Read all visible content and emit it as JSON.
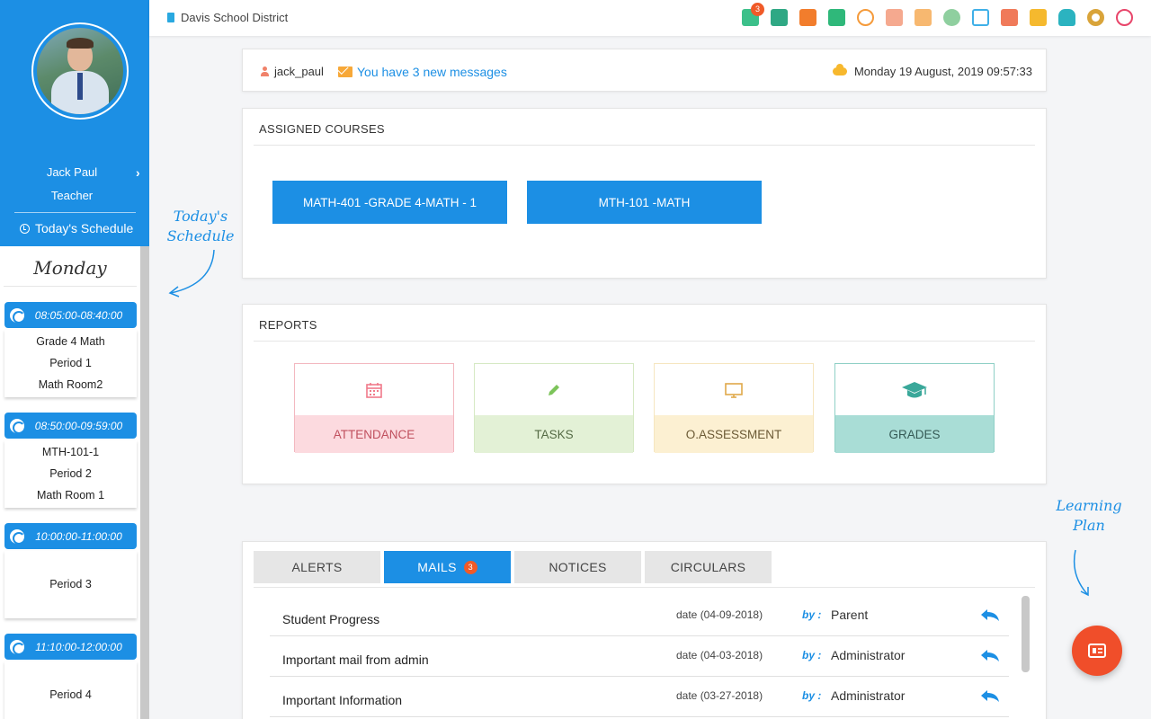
{
  "app": {
    "district": "Davis School District"
  },
  "topbar": {
    "icons": [
      {
        "name": "mail-icon",
        "color": "#3cc08a",
        "badge": "3"
      },
      {
        "name": "folder-icon",
        "color": "#2fa884"
      },
      {
        "name": "contact-card-icon",
        "color": "#f27d2c"
      },
      {
        "name": "presentation-icon",
        "color": "#2fb87a"
      },
      {
        "name": "gauge-icon",
        "color": "#f59a3a"
      },
      {
        "name": "id-card-icon",
        "color": "#f07a5a"
      },
      {
        "name": "bar-chart-icon",
        "color": "#f59a3a"
      },
      {
        "name": "alert-icon",
        "color": "#8fcf9f"
      },
      {
        "name": "folder-outline-icon",
        "color": "#3fb0e8"
      },
      {
        "name": "question-icon",
        "color": "#f07a5a"
      },
      {
        "name": "calendar-icon",
        "color": "#f5b92e"
      },
      {
        "name": "book-reader-icon",
        "color": "#2bb3c0"
      },
      {
        "name": "gear-icon",
        "color": "#d9a43a"
      },
      {
        "name": "power-icon",
        "color": "#e8456a"
      }
    ]
  },
  "sidebar": {
    "name": "Jack Paul",
    "role": "Teacher",
    "schedule_link": "Today's Schedule",
    "day": "Monday",
    "slots": [
      {
        "time": "08:05:00-08:40:00",
        "lines": [
          "Grade 4 Math",
          "Period 1",
          "Math Room2"
        ]
      },
      {
        "time": "08:50:00-09:59:00",
        "lines": [
          "MTH-101-1",
          "Period 2",
          "Math Room 1"
        ]
      },
      {
        "time": "10:00:00-11:00:00",
        "lines": [
          "",
          "Period 3",
          ""
        ]
      },
      {
        "time": "11:10:00-12:00:00",
        "lines": [
          "",
          "Period 4",
          ""
        ]
      }
    ]
  },
  "header": {
    "username": "jack_paul",
    "messages": "You have 3 new messages",
    "datetime": "Monday 19 August, 2019 09:57:33"
  },
  "courses": {
    "title": "ASSIGNED COURSES",
    "items": [
      "MATH-401 -GRADE 4-MATH - 1",
      "MTH-101 -MATH"
    ]
  },
  "reports": {
    "title": "REPORTS",
    "items": [
      {
        "label": "ATTENDANCE",
        "icon": "calendar-icon",
        "border": "#f3b8c0",
        "bg": "#fcdadf",
        "color": "#c0505e",
        "icon_color": "#f07a8a"
      },
      {
        "label": "TASKS",
        "icon": "pencil-icon",
        "border": "#d6e9c4",
        "bg": "#e3f1d6",
        "color": "#556b45",
        "icon_color": "#7cc45a"
      },
      {
        "label": "O.ASSESSMENT",
        "icon": "monitor-icon",
        "border": "#f6e6c0",
        "bg": "#fcf0d2",
        "color": "#6b5a35",
        "icon_color": "#e0a84a"
      },
      {
        "label": "GRADES",
        "icon": "graduation-cap-icon",
        "border": "#8fd0c6",
        "bg": "#a9ddd6",
        "color": "#355a55",
        "icon_color": "#3aa89a"
      }
    ]
  },
  "tabs": {
    "items": [
      "ALERTS",
      "MAILS",
      "NOTICES",
      "CIRCULARS"
    ],
    "mails_count": "3"
  },
  "mails": {
    "by_label": "by :",
    "rows": [
      {
        "subject": "Student Progress",
        "date": "date (04-09-2018)",
        "from": "Parent"
      },
      {
        "subject": "Important mail from admin",
        "date": "date (04-03-2018)",
        "from": "Administrator"
      },
      {
        "subject": "Important Information",
        "date": "date (03-27-2018)",
        "from": "Administrator"
      }
    ]
  },
  "annotations": {
    "schedule_line1": "Today's",
    "schedule_line2": "Schedule",
    "plan_line1": "Learning",
    "plan_line2": "Plan"
  }
}
